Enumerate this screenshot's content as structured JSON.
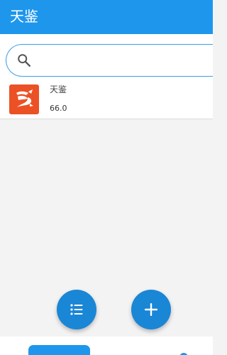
{
  "appbar": {
    "title": "天鉴"
  },
  "search": {
    "placeholder": "",
    "value": ""
  },
  "list": [
    {
      "name": "天鉴",
      "version": "66.0",
      "icon": "app-logo-icon"
    }
  ],
  "fabs": {
    "list_icon": "list-icon",
    "add_icon": "add-icon"
  },
  "colors": {
    "primary": "#1e96ec",
    "fab": "#1a86d6",
    "app_icon_bg": "#ec5125",
    "background": "#f3f3f3"
  }
}
